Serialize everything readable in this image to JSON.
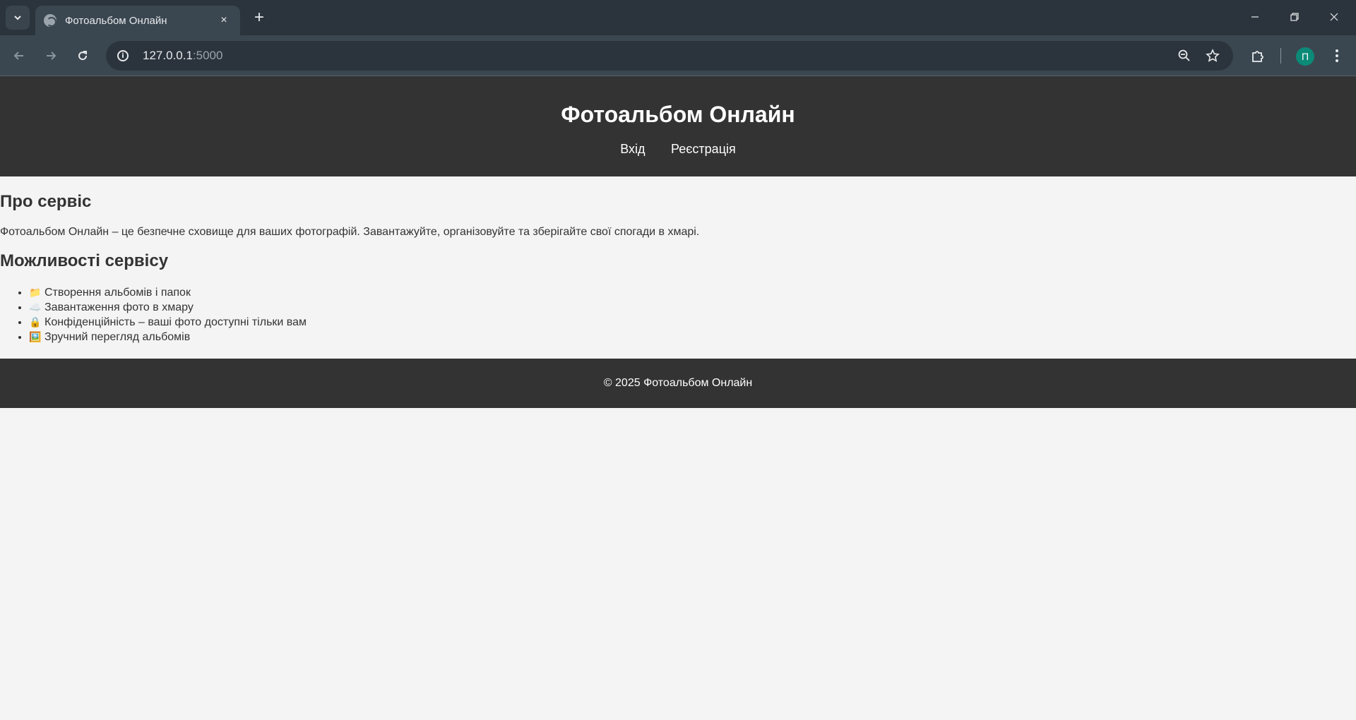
{
  "browser": {
    "tab": {
      "title": "Фотоальбом Онлайн",
      "close_icon": "×"
    },
    "new_tab_icon": "+",
    "url": {
      "host": "127.0.0.1",
      "port": ":5000"
    },
    "profile_initial": "П"
  },
  "site": {
    "title": "Фотоальбом Онлайн",
    "nav": {
      "login": "Вхід",
      "register": "Реєстрація"
    }
  },
  "about": {
    "heading": "Про сервіс",
    "text": "Фотоальбом Онлайн – це безпечне сховище для ваших фотографій. Завантажуйте, організовуйте та зберігайте свої спогади в хмарі."
  },
  "features": {
    "heading": "Можливості сервісу",
    "items": [
      {
        "icon": "📁",
        "icon_name": "folder-icon",
        "text": "Створення альбомів і папок"
      },
      {
        "icon": "☁️",
        "icon_name": "cloud-icon",
        "text": "Завантаження фото в хмару"
      },
      {
        "icon": "🔒",
        "icon_name": "lock-icon",
        "text": "Конфіденційність – ваші фото доступні тільки вам"
      },
      {
        "icon": "🖼️",
        "icon_name": "picture-icon",
        "text": "Зручний перегляд альбомів"
      }
    ]
  },
  "footer": {
    "text": "© 2025 Фотоальбом Онлайн"
  },
  "colors": {
    "header_bg": "#333333",
    "page_bg": "#f4f4f4",
    "chrome_bg": "#2b343c",
    "avatar_bg": "#0b8a78"
  }
}
